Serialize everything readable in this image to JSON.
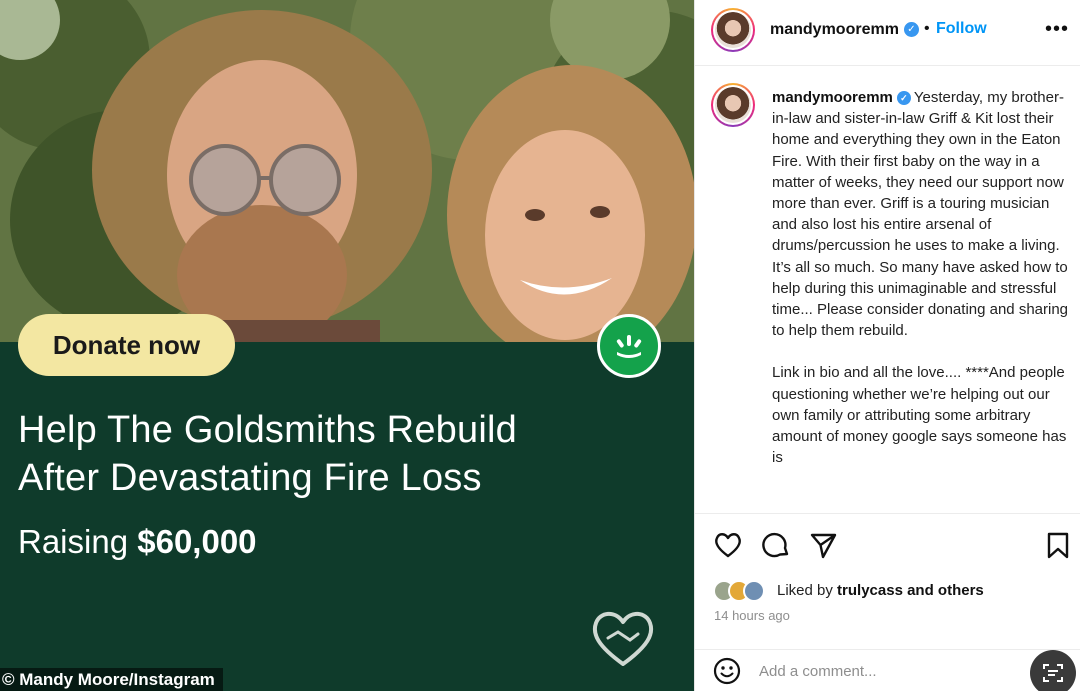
{
  "media": {
    "donate_label": "Donate now",
    "campaign_title_line1": "Help The Goldsmiths Rebuild",
    "campaign_title_line2": "After Devastating Fire Loss",
    "raising_label": "Raising",
    "raising_amount": "$60,000",
    "credit": "© Mandy Moore/Instagram",
    "badge_icon": "gofundme-logo-icon",
    "heart_icon": "heart-handshake-icon",
    "colors": {
      "card_bg": "#0f3b2b",
      "donate_bg": "#f3e7a2",
      "badge": "#14a24b"
    }
  },
  "post": {
    "header": {
      "username": "mandymooremm",
      "separator": "•",
      "follow_label": "Follow",
      "more_label": "•••"
    },
    "caption": {
      "username": "mandymooremm",
      "paragraph1": "Yesterday, my brother-in-law and sister-in-law Griff & Kit lost their home and everything they own in the Eaton Fire. With their first baby on the way in a matter of weeks, they need our support now more than ever. Griff is a touring musician and also lost his entire arsenal of drums/percussion he uses to make a living. It’s all so much. So many have asked how to help during this unimaginable and stressful time... Please consider donating and sharing to help them rebuild.",
      "paragraph2": "Link in bio and all the love.... ****And people questioning whether we’re helping out our own family or attributing some arbitrary amount of money google says someone has is"
    },
    "actions": {
      "like_icon": "heart-icon",
      "comment_icon": "comment-icon",
      "share_icon": "send-icon",
      "save_icon": "bookmark-icon"
    },
    "likes": {
      "prefix": "Liked by",
      "user": "trulycass",
      "suffix": "and others"
    },
    "timestamp": "14 hours ago",
    "comment": {
      "placeholder": "Add a comment...",
      "emoji_icon": "emoji-icon",
      "lens_icon": "lens-icon"
    },
    "colors": {
      "follow": "#0095f6",
      "verified": "#3897f0",
      "timestamp": "#8e8e8e"
    }
  }
}
